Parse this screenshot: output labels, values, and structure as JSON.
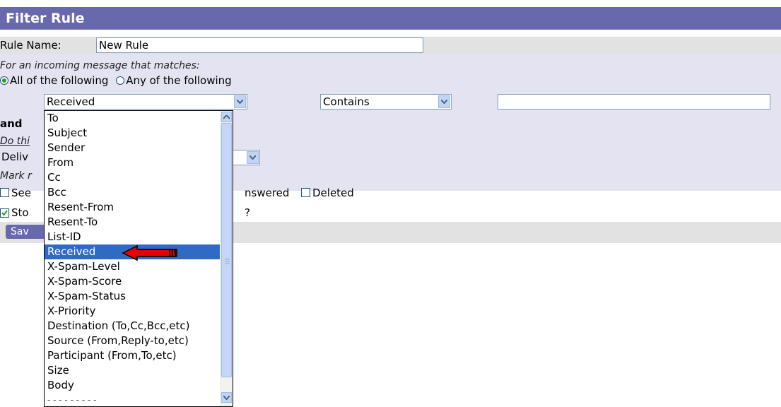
{
  "title": "Filter Rule",
  "rule_name": {
    "label": "Rule Name:",
    "value": "New Rule"
  },
  "match": {
    "prompt": "For an incoming message that matches:",
    "all_label": "All of the following",
    "any_label": "Any of the following",
    "selected": "all"
  },
  "condition": {
    "field_value": "Received",
    "operator_value": "Contains",
    "text_value": ""
  },
  "and_label": "and",
  "action": {
    "prompt_partial": "Do thi",
    "select_partial": "Deliv"
  },
  "mark": {
    "prompt_partial": "Mark r",
    "seen_partial": "See",
    "answered_partial": "nswered",
    "deleted_label": "Deleted"
  },
  "stop": {
    "partial": "Sto",
    "qmark": "?",
    "checked": true
  },
  "save_partial": "Sav",
  "dropdown_items": [
    "To",
    "Subject",
    "Sender",
    "From",
    "Cc",
    "Bcc",
    "Resent-From",
    "Resent-To",
    "List-ID",
    "Received",
    "X-Spam-Level",
    "X-Spam-Score",
    "X-Spam-Status",
    "X-Priority",
    "Destination (To,Cc,Bcc,etc)",
    "Source (From,Reply-to,etc)",
    "Participant (From,To,etc)",
    "Size",
    "Body",
    "- - - - - - - - -"
  ],
  "selected_item": "Received",
  "colors": {
    "header": "#6868ad",
    "selection": "#316ac5",
    "annotation_arrow": "#e60000"
  }
}
